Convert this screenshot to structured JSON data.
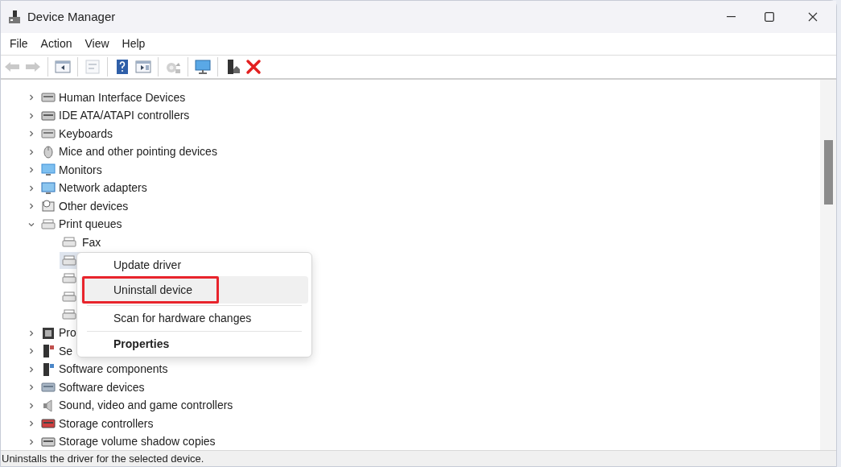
{
  "window": {
    "title": "Device Manager"
  },
  "menu_bar": [
    "File",
    "Action",
    "View",
    "Help"
  ],
  "toolbar": [
    {
      "kind": "back",
      "disabled": true
    },
    {
      "kind": "forward",
      "disabled": true
    },
    {
      "kind": "separator"
    },
    {
      "kind": "tree",
      "disabled": false
    },
    {
      "kind": "separator"
    },
    {
      "kind": "properties",
      "disabled": true
    },
    {
      "kind": "separator"
    },
    {
      "kind": "help",
      "disabled": false
    },
    {
      "kind": "action_pane",
      "disabled": false
    },
    {
      "kind": "separator"
    },
    {
      "kind": "scan",
      "disabled": true
    },
    {
      "kind": "separator"
    },
    {
      "kind": "monitor",
      "disabled": false
    },
    {
      "kind": "separator"
    },
    {
      "kind": "update_driver",
      "disabled": false
    },
    {
      "kind": "uninstall",
      "disabled": false
    }
  ],
  "tree": [
    {
      "label": "Human Interface Devices",
      "kind": "hid",
      "expanded": false
    },
    {
      "label": "IDE ATA/ATAPI controllers",
      "kind": "ide",
      "expanded": false
    },
    {
      "label": "Keyboards",
      "kind": "keyboard",
      "expanded": false
    },
    {
      "label": "Mice and other pointing devices",
      "kind": "mouse",
      "expanded": false
    },
    {
      "label": "Monitors",
      "kind": "monitor",
      "expanded": false
    },
    {
      "label": "Network adapters",
      "kind": "network",
      "expanded": false
    },
    {
      "label": "Other devices",
      "kind": "other",
      "expanded": false
    },
    {
      "label": "Print queues",
      "kind": "printer",
      "expanded": true,
      "children": [
        {
          "label": "Fax",
          "kind": "printer",
          "selected": false
        },
        {
          "kind": "printer",
          "selected": true
        },
        {
          "kind": "printer",
          "selected": false
        },
        {
          "kind": "printer",
          "selected": false
        },
        {
          "kind": "printer",
          "selected": false
        }
      ]
    },
    {
      "label": "Pro",
      "kind": "processor",
      "expanded": false
    },
    {
      "label": "Se",
      "kind": "security",
      "expanded": false
    },
    {
      "label": "Software components",
      "kind": "software",
      "expanded": false
    },
    {
      "label": "Software devices",
      "kind": "software_device",
      "expanded": false
    },
    {
      "label": "Sound, video and game controllers",
      "kind": "sound",
      "expanded": false
    },
    {
      "label": "Storage controllers",
      "kind": "storage",
      "expanded": false
    },
    {
      "label": "Storage volume shadow copies",
      "kind": "disk",
      "expanded": false
    }
  ],
  "context_menu": [
    {
      "kind": "item",
      "label": "Update driver",
      "selected": false,
      "annotated": false,
      "bold": false
    },
    {
      "kind": "item",
      "label": "Uninstall device",
      "selected": true,
      "annotated": true,
      "bold": false
    },
    {
      "kind": "separator"
    },
    {
      "kind": "item",
      "label": "Scan for hardware changes",
      "selected": false,
      "annotated": false,
      "bold": false
    },
    {
      "kind": "separator"
    },
    {
      "kind": "item",
      "label": "Properties",
      "selected": false,
      "annotated": false,
      "bold": true
    }
  ],
  "status_bar": "Uninstalls the driver for the selected device."
}
